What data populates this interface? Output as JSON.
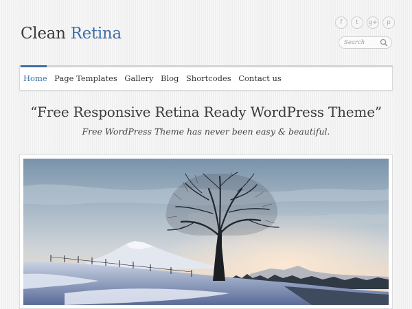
{
  "site": {
    "logo_part1": "Clean",
    "logo_part2": "Retina"
  },
  "social": [
    {
      "name": "facebook-icon",
      "glyph": "f"
    },
    {
      "name": "twitter-icon",
      "glyph": "t"
    },
    {
      "name": "google-plus-icon",
      "glyph": "g+"
    },
    {
      "name": "pinterest-icon",
      "glyph": "p"
    }
  ],
  "search": {
    "placeholder": "Search"
  },
  "nav": {
    "items": [
      {
        "label": "Home",
        "active": true
      },
      {
        "label": "Page Templates",
        "active": false
      },
      {
        "label": "Gallery",
        "active": false
      },
      {
        "label": "Blog",
        "active": false
      },
      {
        "label": "Shortcodes",
        "active": false
      },
      {
        "label": "Contact us",
        "active": false
      }
    ]
  },
  "hero": {
    "headline": "“Free Responsive Retina Ready WordPress Theme”",
    "tagline": "Free WordPress Theme has never been easy & beautiful."
  },
  "colors": {
    "accent": "#3d6ea5",
    "text": "#3b3b3b",
    "background": "#f1f1f1"
  }
}
